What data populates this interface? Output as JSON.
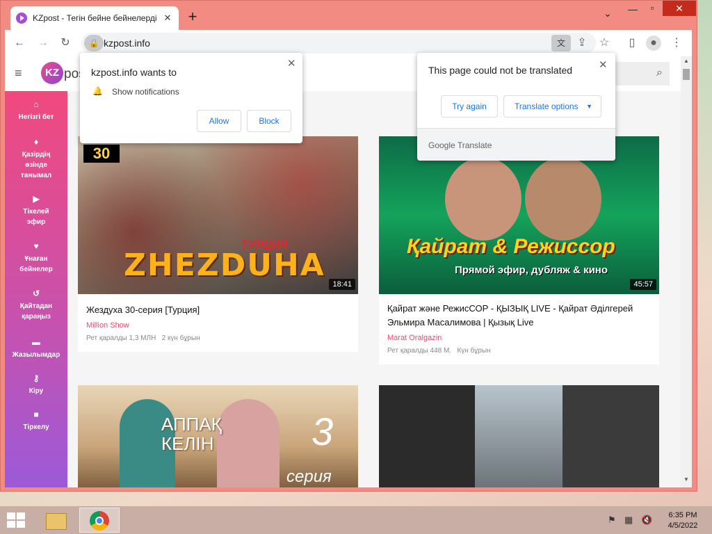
{
  "browser": {
    "tab_title": "KZpost - Тегін бейне бейнелерді",
    "url": "kzpost.info"
  },
  "site": {
    "logo": "KZ",
    "logo_text": "post"
  },
  "sidebar": {
    "items": [
      {
        "label": "Негізгі бет"
      },
      {
        "label": "Қазірдің өзінде танымал"
      },
      {
        "label": "Тікелей эфир"
      },
      {
        "label": "Ұнаған бейнелер"
      },
      {
        "label": "Қайтадан қараңыз"
      },
      {
        "label": "Жазылымдар"
      },
      {
        "label": "Кіру"
      },
      {
        "label": "Тіркелу"
      }
    ]
  },
  "videos": [
    {
      "title": "Жездуха 30-серия [Турция]",
      "channel": "Million Show",
      "views": "Рет қаралды 1,3 МЛН",
      "age": "2 күн бұрын",
      "duration": "18:41",
      "thumb_text": "ZHEZDUHA",
      "thumb_badge": "30",
      "thumb_sub": "ТУРЦИЯ"
    },
    {
      "title": "Қайрат және РежисСОР - ҚЫЗЫҚ LIVE - Қайрат Әділгерей Эльмира Масалимова | Қызық Live",
      "channel": "Marat Oralgazin",
      "views": "Рет қаралды 448 М.",
      "age": "Күн бұрын",
      "duration": "45:57",
      "thumb_text": "Қайрат & Режиссор",
      "thumb_sub": "Прямой эфир, дубляж & кино"
    },
    {
      "thumb_text": "АППАҚ КЕЛІН",
      "thumb_badge": "3",
      "thumb_sub": "серия"
    },
    {
      "thumb_text": ""
    }
  ],
  "notification_popup": {
    "title": "kzpost.info wants to",
    "permission": "Show notifications",
    "allow": "Allow",
    "block": "Block"
  },
  "translate_popup": {
    "message": "This page could not be translated",
    "try_again": "Try again",
    "options": "Translate options",
    "brand": "Google Translate"
  },
  "taskbar": {
    "time": "6:35 PM",
    "date": "4/5/2022"
  },
  "colors": {
    "accent": "#1a73e8",
    "sidebar_top": "#f1497e",
    "sidebar_bottom": "#9b5ad8",
    "channel": "#e84c6f",
    "window_frame": "#f28b82"
  }
}
